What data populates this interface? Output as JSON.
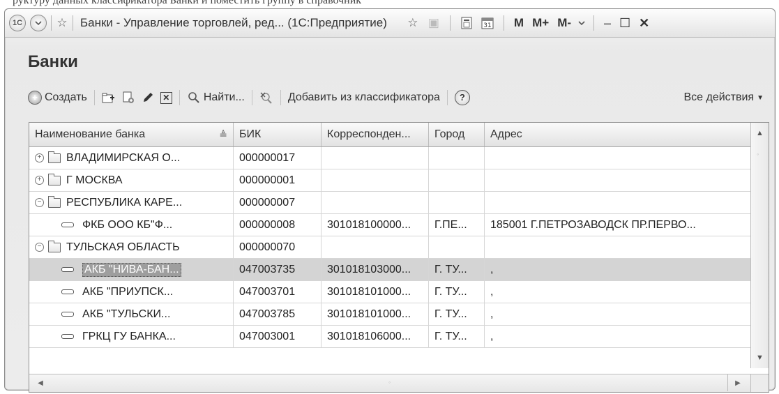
{
  "window": {
    "title": "Банки - Управление торговлей, ред... (1С:Предприятие)",
    "app_icon": "1С",
    "m_buttons": [
      "M",
      "M+",
      "M-"
    ]
  },
  "page": {
    "heading": "Банки"
  },
  "toolbar": {
    "create_label": "Создать",
    "find_label": "Найти...",
    "add_from_classifier_label": "Добавить из классификатора",
    "help_label": "?",
    "all_actions_label": "Все действия"
  },
  "grid": {
    "columns": [
      "Наименование банка",
      "БИК",
      "Корреспонден...",
      "Город",
      "Адрес"
    ],
    "rows": [
      {
        "type": "group",
        "expanded": false,
        "name": "ВЛАДИМИРСКАЯ О...",
        "bik": "000000017",
        "corr": "",
        "city": "",
        "address": ""
      },
      {
        "type": "group",
        "expanded": false,
        "name": "Г МОСКВА",
        "bik": "000000001",
        "corr": "",
        "city": "",
        "address": ""
      },
      {
        "type": "group",
        "expanded": true,
        "name": "РЕСПУБЛИКА КАРЕ...",
        "bik": "000000007",
        "corr": "",
        "city": "",
        "address": ""
      },
      {
        "type": "item",
        "name": "ФКБ ООО КБ\"Ф...",
        "bik": "000000008",
        "corr": "301018100000...",
        "city": "Г.ПЕ...",
        "address": "185001 Г.ПЕТРОЗАВОДСК ПР.ПЕРВО..."
      },
      {
        "type": "group",
        "expanded": true,
        "name": "ТУЛЬСКАЯ ОБЛАСТЬ",
        "bik": "000000070",
        "corr": "",
        "city": "",
        "address": ""
      },
      {
        "type": "item",
        "selected": true,
        "name": "АКБ \"НИВА-БАН...",
        "bik": "047003735",
        "corr": "301018103000...",
        "city": "Г. ТУ...",
        "address": ","
      },
      {
        "type": "item",
        "name": "АКБ \"ПРИУПСК...",
        "bik": "047003701",
        "corr": "301018101000...",
        "city": "Г. ТУ...",
        "address": ","
      },
      {
        "type": "item",
        "name": "АКБ \"ТУЛЬСКИ...",
        "bik": "047003785",
        "corr": "301018101000...",
        "city": "Г. ТУ...",
        "address": ","
      },
      {
        "type": "item",
        "name": "ГРКЦ ГУ БАНКА...",
        "bik": "047003001",
        "corr": "301018106000...",
        "city": "Г. ТУ...",
        "address": ","
      }
    ]
  }
}
